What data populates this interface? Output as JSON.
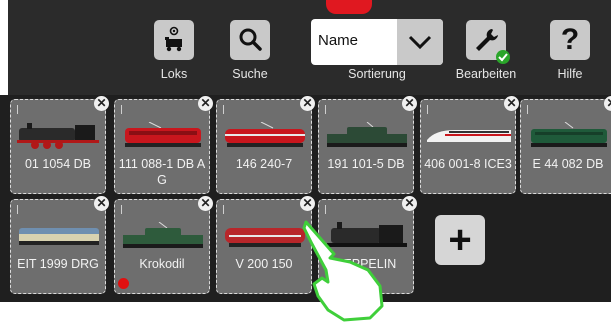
{
  "toolbar": {
    "loks_label": "Loks",
    "suche_label": "Suche",
    "sort_value": "Name",
    "sort_label": "Sortierung",
    "bearbeiten_label": "Bearbeiten",
    "hilfe_label": "Hilfe",
    "hilfe_glyph": "?"
  },
  "locos": [
    {
      "label": "01 1054 DB",
      "color": "#333333",
      "icon": "steam-loco-icon"
    },
    {
      "label": "111 088-1 DB AG",
      "color": "#c8161d",
      "icon": "electric-loco-icon"
    },
    {
      "label": "146 240-7",
      "color": "#c8161d",
      "icon": "electric-loco-icon"
    },
    {
      "label": "191 101-5 DB",
      "color": "#2c4a36",
      "icon": "crocodile-loco-icon"
    },
    {
      "label": "406 001-8 ICE3",
      "color": "#f2f2f2",
      "icon": "ice-train-icon"
    },
    {
      "label": "E 44 082 DB",
      "color": "#1f5a3a",
      "icon": "electric-loco-icon"
    },
    {
      "label": "EIT 1999 DRG",
      "color": "#d8d2b0",
      "icon": "railcar-icon"
    },
    {
      "label": "Krokodil",
      "color": "#2e5b3c",
      "icon": "crocodile-loco-icon"
    },
    {
      "label": "V 200 150",
      "color": "#b8262a",
      "icon": "diesel-loco-icon"
    },
    {
      "label": "ZEPPELIN",
      "color": "#2a2a2a",
      "icon": "steam-loco-icon"
    }
  ],
  "close_glyph": "✕",
  "add_glyph": "+"
}
